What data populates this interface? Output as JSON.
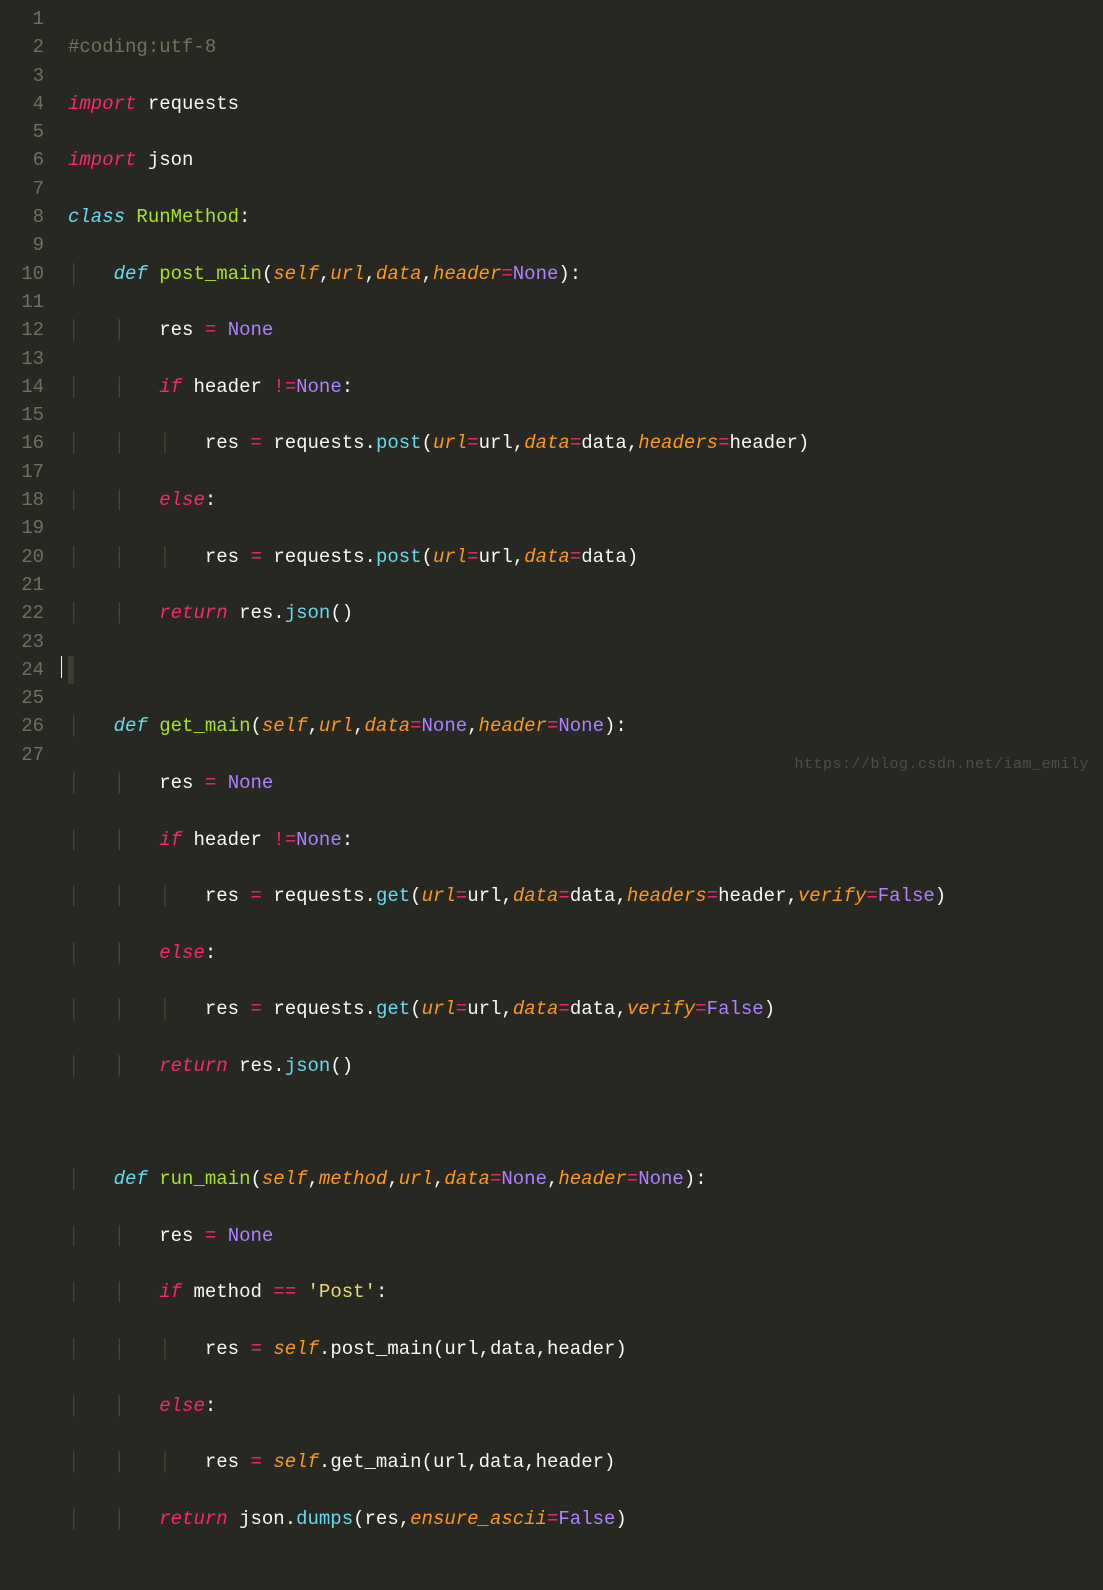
{
  "watermark": "https://blog.csdn.net/iam_emily",
  "gutter": [
    "1",
    "2",
    "3",
    "4",
    "5",
    "6",
    "7",
    "8",
    "9",
    "10",
    "11",
    "12",
    "13",
    "14",
    "15",
    "16",
    "17",
    "18",
    "19",
    "20",
    "21",
    "22",
    "23",
    "24",
    "25",
    "26",
    "27"
  ],
  "t": {
    "comment1": "#coding:utf-8",
    "import": "import",
    "requests": "requests",
    "json": "json",
    "class": "class",
    "RunMethod": "RunMethod",
    "colon": ":",
    "def": "def",
    "post_main": "post_main",
    "get_main": "get_main",
    "run_main": "run_main",
    "lpar": "(",
    "rpar": ")",
    "self": "self",
    "comma": ",",
    "url": "url",
    "data": "data",
    "header": "header",
    "headers": "headers",
    "method": "method",
    "verify": "verify",
    "eq": "=",
    "None": "None",
    "False": "False",
    "res": "res",
    "if": "if",
    "neq": "!=",
    "eqeq": "==",
    "else": "else",
    "return": "return",
    "dot": ".",
    "post": "post",
    "get": "get",
    "jsonfn": "json",
    "dumps": "dumps",
    "ensure_ascii": "ensure_ascii",
    "sq": "'",
    "Post": "Post",
    "guide": "│",
    "sp": " "
  }
}
